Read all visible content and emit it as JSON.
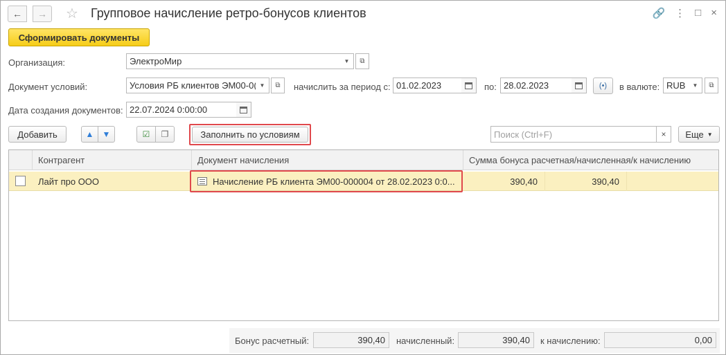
{
  "window": {
    "title": "Групповое начисление ретро-бонусов клиентов",
    "nav_back": "←",
    "nav_forward": "→",
    "star": "☆",
    "link": "🔗",
    "menu": "⋮",
    "maximize": "□",
    "close": "×"
  },
  "toolbar": {
    "generate_label": "Сформировать документы"
  },
  "form": {
    "organization_label": "Организация:",
    "organization_value": "ЭлектроМир",
    "terms_doc_label": "Документ условий:",
    "terms_doc_value": "Условия РБ клиентов ЭМ00-0(",
    "period_label": "начислить за период с:",
    "period_from": "01.02.2023",
    "period_to_label": "по:",
    "period_to": "28.02.2023",
    "currency_label": "в валюте:",
    "currency_value": "RUB",
    "created_label": "Дата создания документов:",
    "created_value": "22.07.2024  0:00:00"
  },
  "table_toolbar": {
    "add_label": "Добавить",
    "fill_label": "Заполнить по условиям",
    "search_placeholder": "Поиск (Ctrl+F)",
    "more_label": "Еще"
  },
  "table": {
    "columns": [
      "Контрагент",
      "Документ начисления",
      "Сумма бонуса расчетная/начисленная/к начислению"
    ],
    "rows": [
      {
        "counterparty": "Лайт про ООО",
        "document": "Начисление РБ клиента ЭМ00-000004 от 28.02.2023 0:0...",
        "calc": "390,40",
        "accrued": "390,40",
        "to_accrue": ""
      }
    ]
  },
  "footer": {
    "calc_label": "Бонус расчетный:",
    "calc_value": "390,40",
    "accrued_label": "начисленный:",
    "accrued_value": "390,40",
    "to_accrue_label": "к начислению:",
    "to_accrue_value": "0,00"
  },
  "colors": {
    "primary_button": "#f6cd18",
    "selected_row": "#fbf0c0",
    "highlight_border": "#e0484c"
  }
}
